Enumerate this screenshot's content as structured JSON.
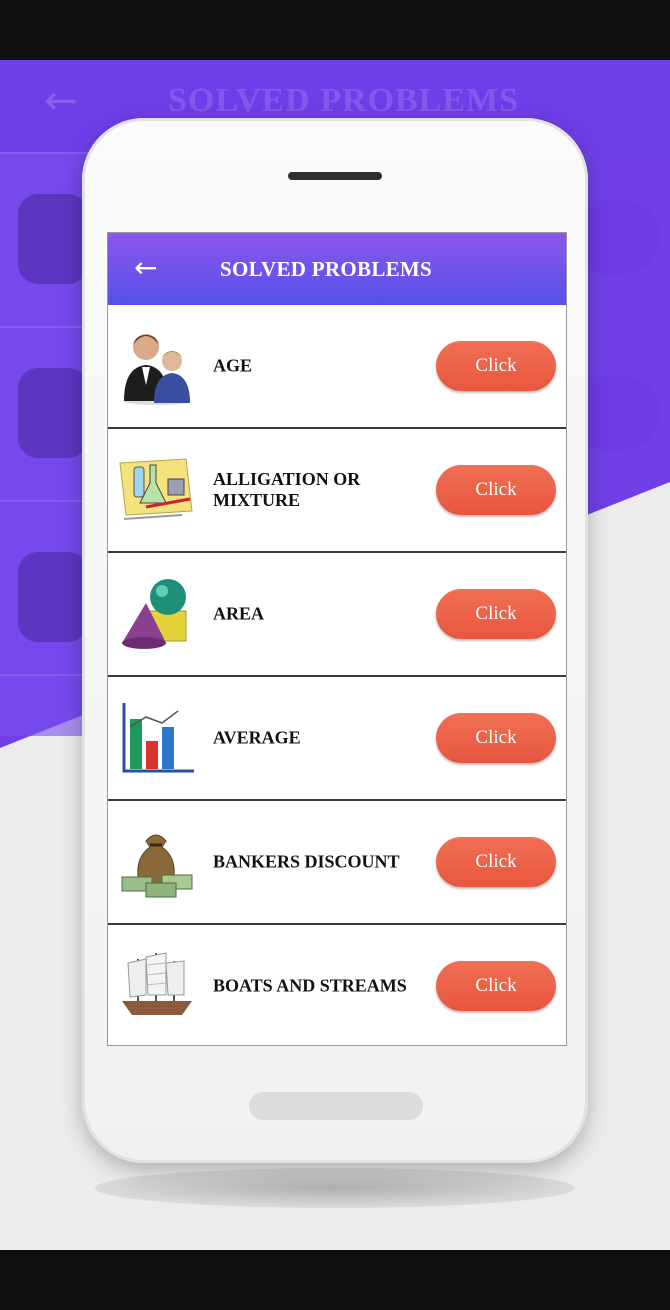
{
  "background": {
    "ghost_title": "SOLVED PROBLEMS",
    "ghost_arrow_icon": "arrow-left-icon",
    "purple": "#7040e6"
  },
  "app": {
    "title": "SOLVED PROBLEMS",
    "back_icon": "arrow-left-icon",
    "header_gradient": [
      "#8b57ee",
      "#5650e6"
    ],
    "accent": "#e8563e"
  },
  "items": [
    {
      "label": "AGE",
      "button": "Click",
      "icon": "people-icon"
    },
    {
      "label": "ALLIGATION OR MIXTURE",
      "button": "Click",
      "icon": "lab-flasks-icon"
    },
    {
      "label": "AREA",
      "button": "Click",
      "icon": "geometric-shapes-icon"
    },
    {
      "label": "AVERAGE",
      "button": "Click",
      "icon": "bar-chart-icon"
    },
    {
      "label": "BANKERS DISCOUNT",
      "button": "Click",
      "icon": "money-bag-icon"
    },
    {
      "label": "BOATS AND STREAMS",
      "button": "Click",
      "icon": "sailing-ship-icon"
    }
  ]
}
